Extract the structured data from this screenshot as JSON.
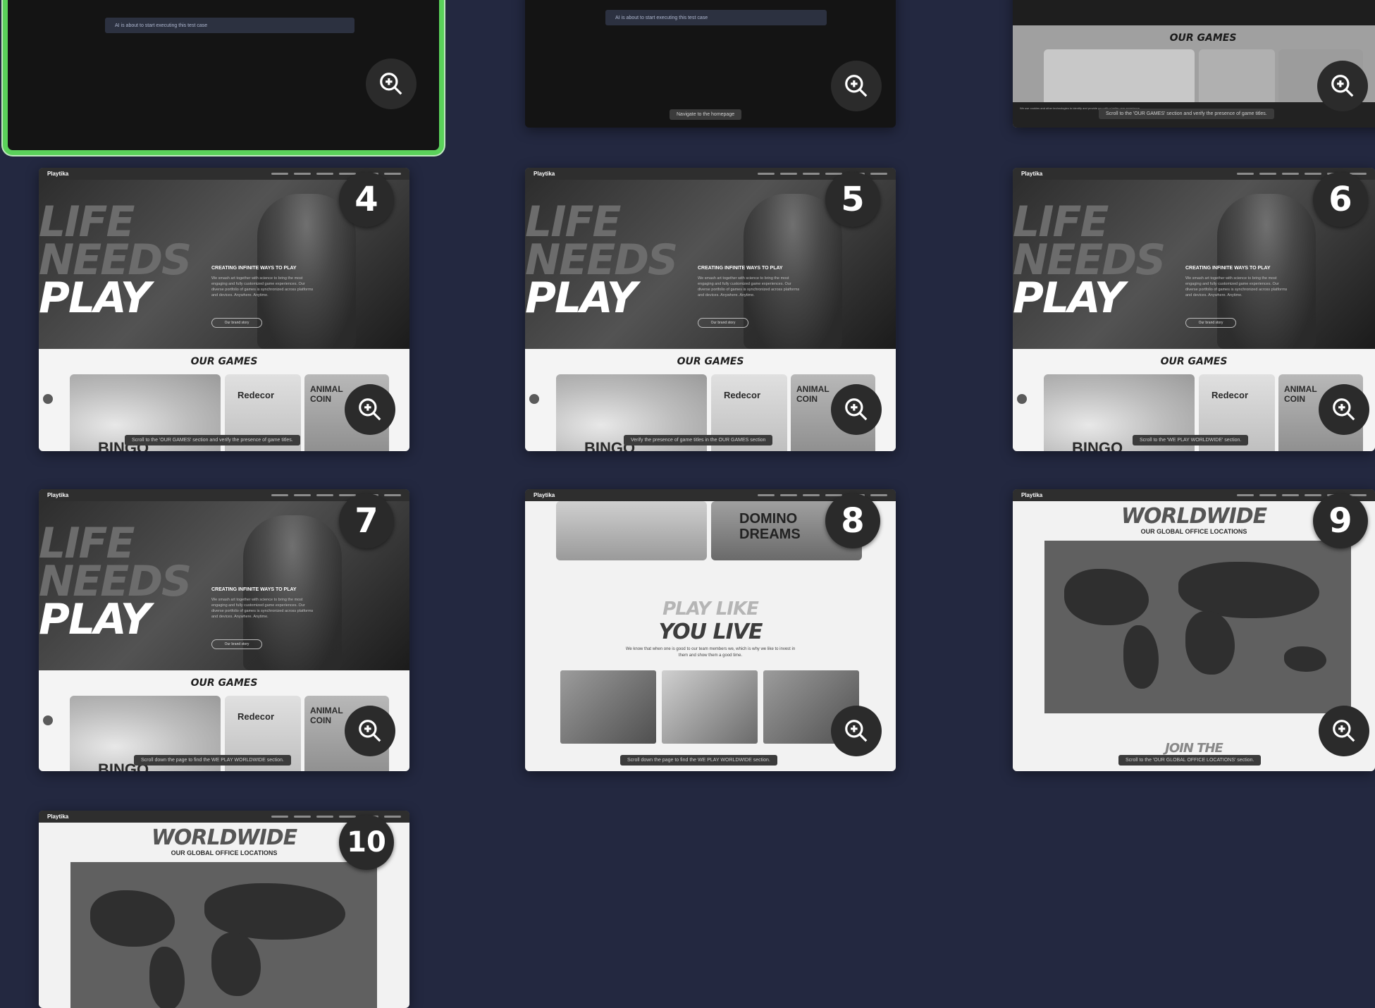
{
  "top_cards": {
    "card1_status": "AI is about to start executing this test case",
    "card2_status": "AI is about to start executing this test case",
    "card2_caption": "Navigate to the homepage",
    "card3_heading": "OUR GAMES",
    "card3_caption": "Scroll to the 'OUR GAMES' section and verify the presence of game titles.",
    "card3_cookie_text": "We use cookies and other technologies to identify and provide you with a better user experience ..."
  },
  "site": {
    "logo": "Playtika",
    "hero_lines": [
      "LIFE",
      "NEEDS",
      "PLAY"
    ],
    "hero_title": "CREATING INFINITE WAYS TO PLAY",
    "hero_text": "We smash art together with science to bring the most engaging and fully customized game experiences. Our diverse portfolio of games is synchronized across platforms and devices. Anywhere. Anytime.",
    "hero_button": "Our brand story",
    "games_heading": "OUR GAMES",
    "tile_words": [
      "BINGO",
      "Redecor",
      "ANIMAL COIN"
    ],
    "domino_word": "DOMINO DREAMS",
    "play_heading_1": "PLAY LIKE",
    "play_heading_2": "YOU LIVE",
    "play_text": "We know that when one is good to our team members we, which is why we like to invest in them and show them a good time.",
    "worldwide_heading": "WORLDWIDE",
    "worldwide_sub": "OUR GLOBAL OFFICE LOCATIONS",
    "join_heading": "JOIN THE"
  },
  "steps": [
    {
      "number": "4",
      "caption": "Scroll to the 'OUR GAMES' section and verify the presence of game titles."
    },
    {
      "number": "5",
      "caption": "Verify the presence of game titles in the OUR GAMES section"
    },
    {
      "number": "6",
      "caption": "Scroll to the 'WE PLAY WORLDWIDE' section."
    },
    {
      "number": "7",
      "caption": "Scroll down the page to find the WE PLAY WORLDWIDE section."
    },
    {
      "number": "8",
      "caption": "Scroll down the page to find the WE PLAY WORLDWIDE section."
    },
    {
      "number": "9",
      "caption": "Scroll to the 'OUR GLOBAL OFFICE LOCATIONS' section."
    },
    {
      "number": "10",
      "caption": ""
    }
  ],
  "colors": {
    "background": "#232840",
    "selected_border": "#5ad15a"
  },
  "icons": {
    "zoom": "zoom-in-icon"
  }
}
